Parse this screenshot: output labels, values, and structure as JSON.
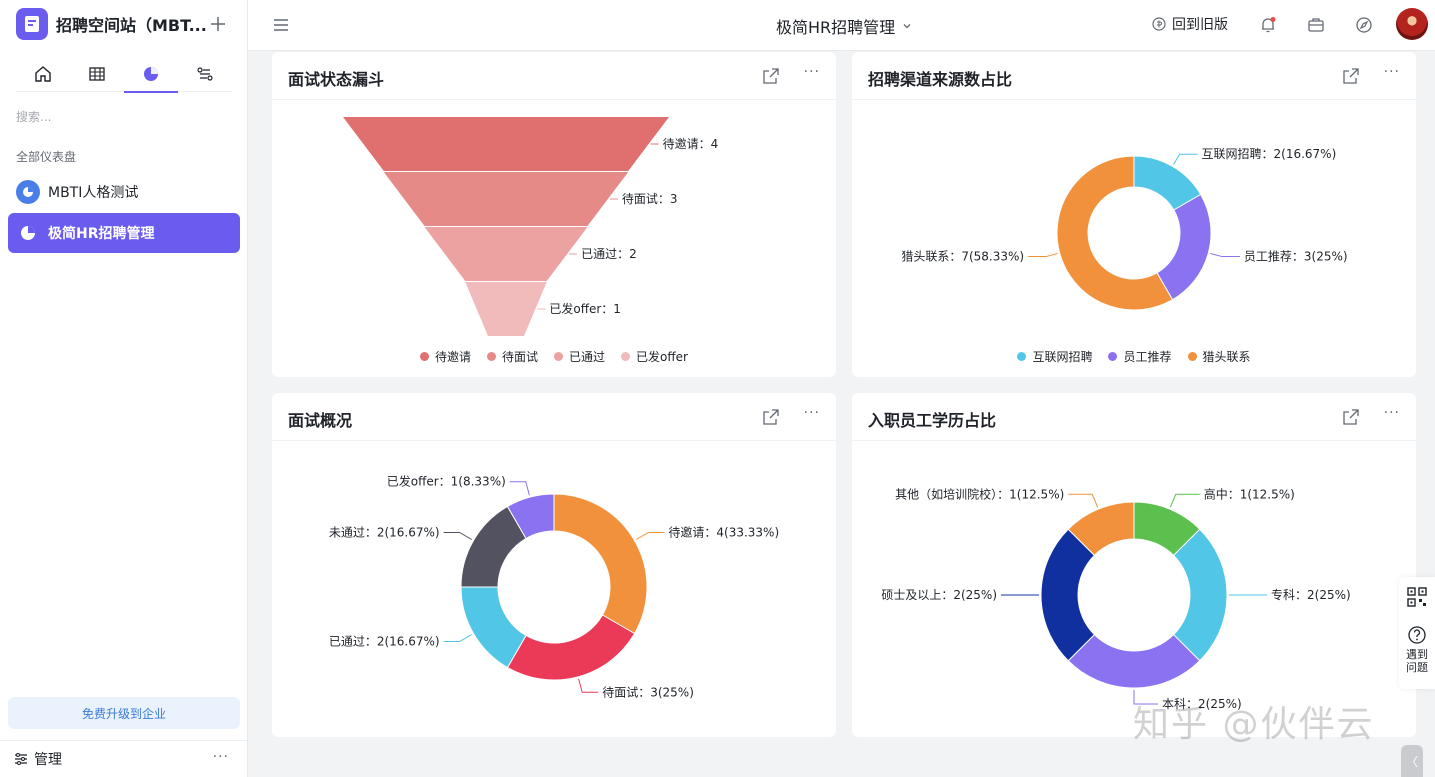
{
  "sidebar": {
    "app_name": "招聘空间站（MBT...",
    "search_placeholder": "搜索...",
    "group_label": "全部仪表盘",
    "items": [
      {
        "label": "MBTI人格测试"
      },
      {
        "label": "极简HR招聘管理"
      }
    ],
    "upgrade_label": "免费升级到企业",
    "footer_label": "管理"
  },
  "topbar": {
    "title": "极简HR招聘管理",
    "back_label": "回到旧版"
  },
  "cards": {
    "funnel": {
      "title": "面试状态漏斗"
    },
    "channel": {
      "title": "招聘渠道来源数占比"
    },
    "overview": {
      "title": "面试概况"
    },
    "education": {
      "title": "入职员工学历占比"
    }
  },
  "float": {
    "help_label": "遇到问题"
  },
  "watermark": "知乎 @伙伴云",
  "chart_data": [
    {
      "type": "funnel",
      "title": "面试状态漏斗",
      "categories": [
        "待邀请",
        "待面试",
        "已通过",
        "已发offer"
      ],
      "values": [
        4,
        3,
        2,
        1
      ],
      "data_labels": [
        "待邀请：4",
        "待面试：3",
        "已通过：2",
        "已发offer：1"
      ],
      "colors": [
        "#e07070",
        "#e68a88",
        "#eba2a1",
        "#f0bbba"
      ],
      "legend_position": "bottom"
    },
    {
      "type": "pie",
      "title": "招聘渠道来源数占比",
      "categories": [
        "互联网招聘",
        "员工推荐",
        "猎头联系"
      ],
      "values": [
        2,
        3,
        7
      ],
      "data_labels": [
        "互联网招聘：2(16.67%)",
        "员工推荐：3(25%)",
        "猎头联系：7(58.33%)"
      ],
      "colors": [
        "#52c6e6",
        "#8a72f0",
        "#f2913c"
      ],
      "legend_position": "bottom"
    },
    {
      "type": "pie",
      "title": "面试概况",
      "categories": [
        "待邀请",
        "待面试",
        "已通过",
        "未通过",
        "已发offer"
      ],
      "values": [
        4,
        3,
        2,
        2,
        1
      ],
      "data_labels": [
        "待邀请：4(33.33%)",
        "待面试：3(25%)",
        "已通过：2(16.67%)",
        "未通过：2(16.67%)",
        "已发offer：1(8.33%)"
      ],
      "colors": [
        "#f2913c",
        "#ea3a57",
        "#52c6e6",
        "#535260",
        "#8a72f0"
      ]
    },
    {
      "type": "pie",
      "title": "入职员工学历占比",
      "categories": [
        "高中",
        "专科",
        "本科",
        "硕士及以上",
        "其他（如培训院校）"
      ],
      "values": [
        1,
        2,
        2,
        2,
        1
      ],
      "data_labels": [
        "高中：1(12.5%)",
        "专科：2(25%)",
        "本科：2(25%)",
        "硕士及以上：2(25%)",
        "其他（如培训院校）：1(12.5%)"
      ],
      "colors": [
        "#5bc04d",
        "#52c6e6",
        "#8a72f0",
        "#1130a0",
        "#f2913c"
      ]
    }
  ]
}
